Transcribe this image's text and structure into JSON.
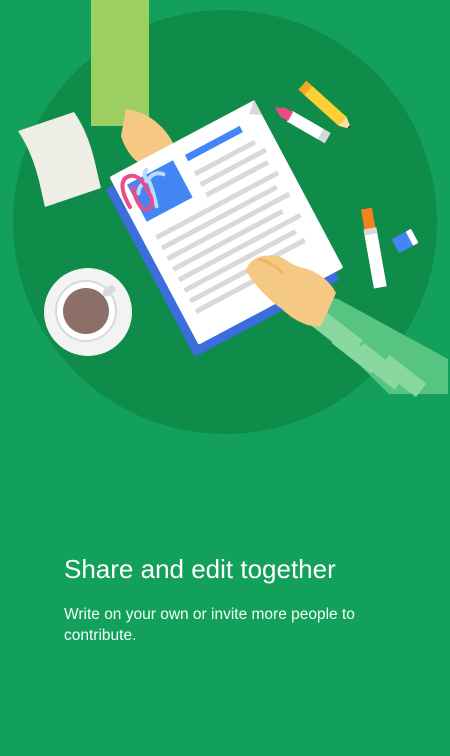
{
  "onboarding": {
    "title": "Share and edit together",
    "subtitle": "Write on your own or invite more people to contribute."
  },
  "colors": {
    "background": "#12a05b",
    "table": "#0f8b4a",
    "text": "#ffffff"
  },
  "illustration": {
    "description_icons": [
      "table-circle",
      "document-illustration",
      "coffee-cup-icon",
      "paper-note-icon",
      "pencil-icon",
      "highlighter-icon",
      "marker-icon",
      "eraser-icon",
      "paperclip-icon"
    ]
  }
}
